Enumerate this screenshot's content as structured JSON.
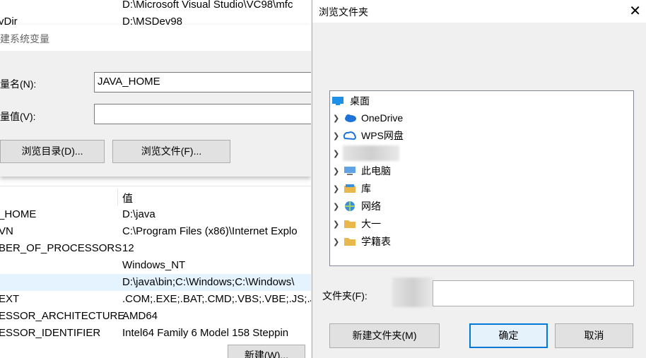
{
  "background_window": {
    "top_rows": [
      {
        "value": "D:\\Microsoft Visual Studio\\VC98\\mfc"
      },
      {
        "name": "vDir",
        "value": "D:\\MSDev98"
      }
    ],
    "edit_dialog": {
      "title": "建系统变量",
      "name_label": "量名(N):",
      "name_value": "JAVA_HOME",
      "value_label": "量值(V):",
      "value_value": "",
      "browse_dir_button": "浏览目录(D)...",
      "browse_file_button": "浏览文件(F)..."
    },
    "table": {
      "header_value": "值",
      "rows": [
        {
          "name": "_HOME",
          "value": "D:\\java"
        },
        {
          "name": "VN",
          "value": "C:\\Program Files (x86)\\Internet Explo"
        },
        {
          "name": "BER_OF_PROCESSORS",
          "value": "12"
        },
        {
          "name": "",
          "value": "Windows_NT"
        },
        {
          "name": "",
          "value": "D:\\java\\bin;C:\\Windows;C:\\Windows\\"
        },
        {
          "name": "EXT",
          "value": ".COM;.EXE;.BAT;.CMD;.VBS;.VBE;.JS;.JS"
        },
        {
          "name": "ESSOR_ARCHITECTURE",
          "value": "AMD64"
        },
        {
          "name": "ESSOR_IDENTIFIER",
          "value": "Intel64 Family 6 Model 158 Steppin"
        }
      ],
      "new_button": "新建(W)..."
    }
  },
  "browse_dialog": {
    "title": "浏览文件夹",
    "tree": [
      {
        "label": "桌面",
        "icon": "desktop-icon"
      },
      {
        "label": "OneDrive",
        "icon": "cloud-icon"
      },
      {
        "label": "WPS网盘",
        "icon": "wps-cloud-icon"
      },
      {
        "label": "",
        "icon": "blurred-icon"
      },
      {
        "label": "此电脑",
        "icon": "computer-icon"
      },
      {
        "label": "库",
        "icon": "library-icon"
      },
      {
        "label": "网络",
        "icon": "network-icon"
      },
      {
        "label": "大一",
        "icon": "folder-icon"
      },
      {
        "label": "学籍表",
        "icon": "folder-icon"
      }
    ],
    "folder_label": "文件夹(F):",
    "folder_value": "",
    "new_folder_button": "新建文件夹(M)",
    "ok_button": "确定",
    "cancel_button": "取消",
    "colors": {
      "accent": "#0078d7",
      "folder": "#e8b84a",
      "cloud": "#1e73d8"
    }
  }
}
